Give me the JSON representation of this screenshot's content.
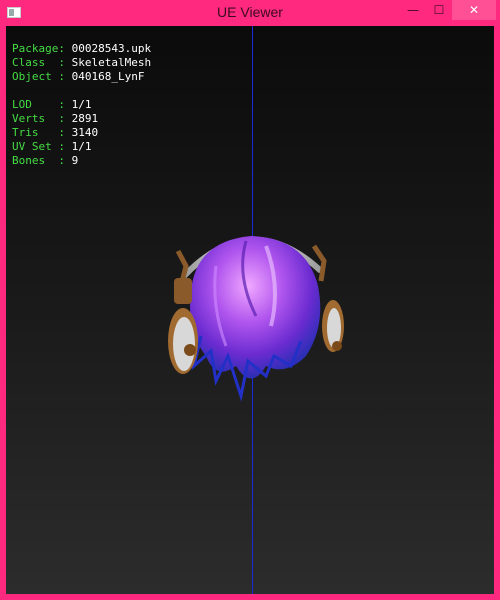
{
  "window": {
    "title": "UE Viewer"
  },
  "controls": {
    "minimize": "—",
    "maximize": "☐",
    "close": "✕"
  },
  "info": {
    "package_label": "Package:",
    "package": "00028543.upk",
    "class_label": "Class  :",
    "class": "SkeletalMesh",
    "object_label": "Object :",
    "object": "040168_LynF",
    "lod_label": "LOD    :",
    "lod": "1/1",
    "verts_label": "Verts  :",
    "verts": "2891",
    "tris_label": "Tris   :",
    "tris": "3140",
    "uvset_label": "UV Set :",
    "uvset": "1/1",
    "bones_label": "Bones  :",
    "bones": "9"
  },
  "colors": {
    "frame": "#ff2a7f",
    "label": "#44dd44",
    "axis": "#1a2bd6"
  }
}
